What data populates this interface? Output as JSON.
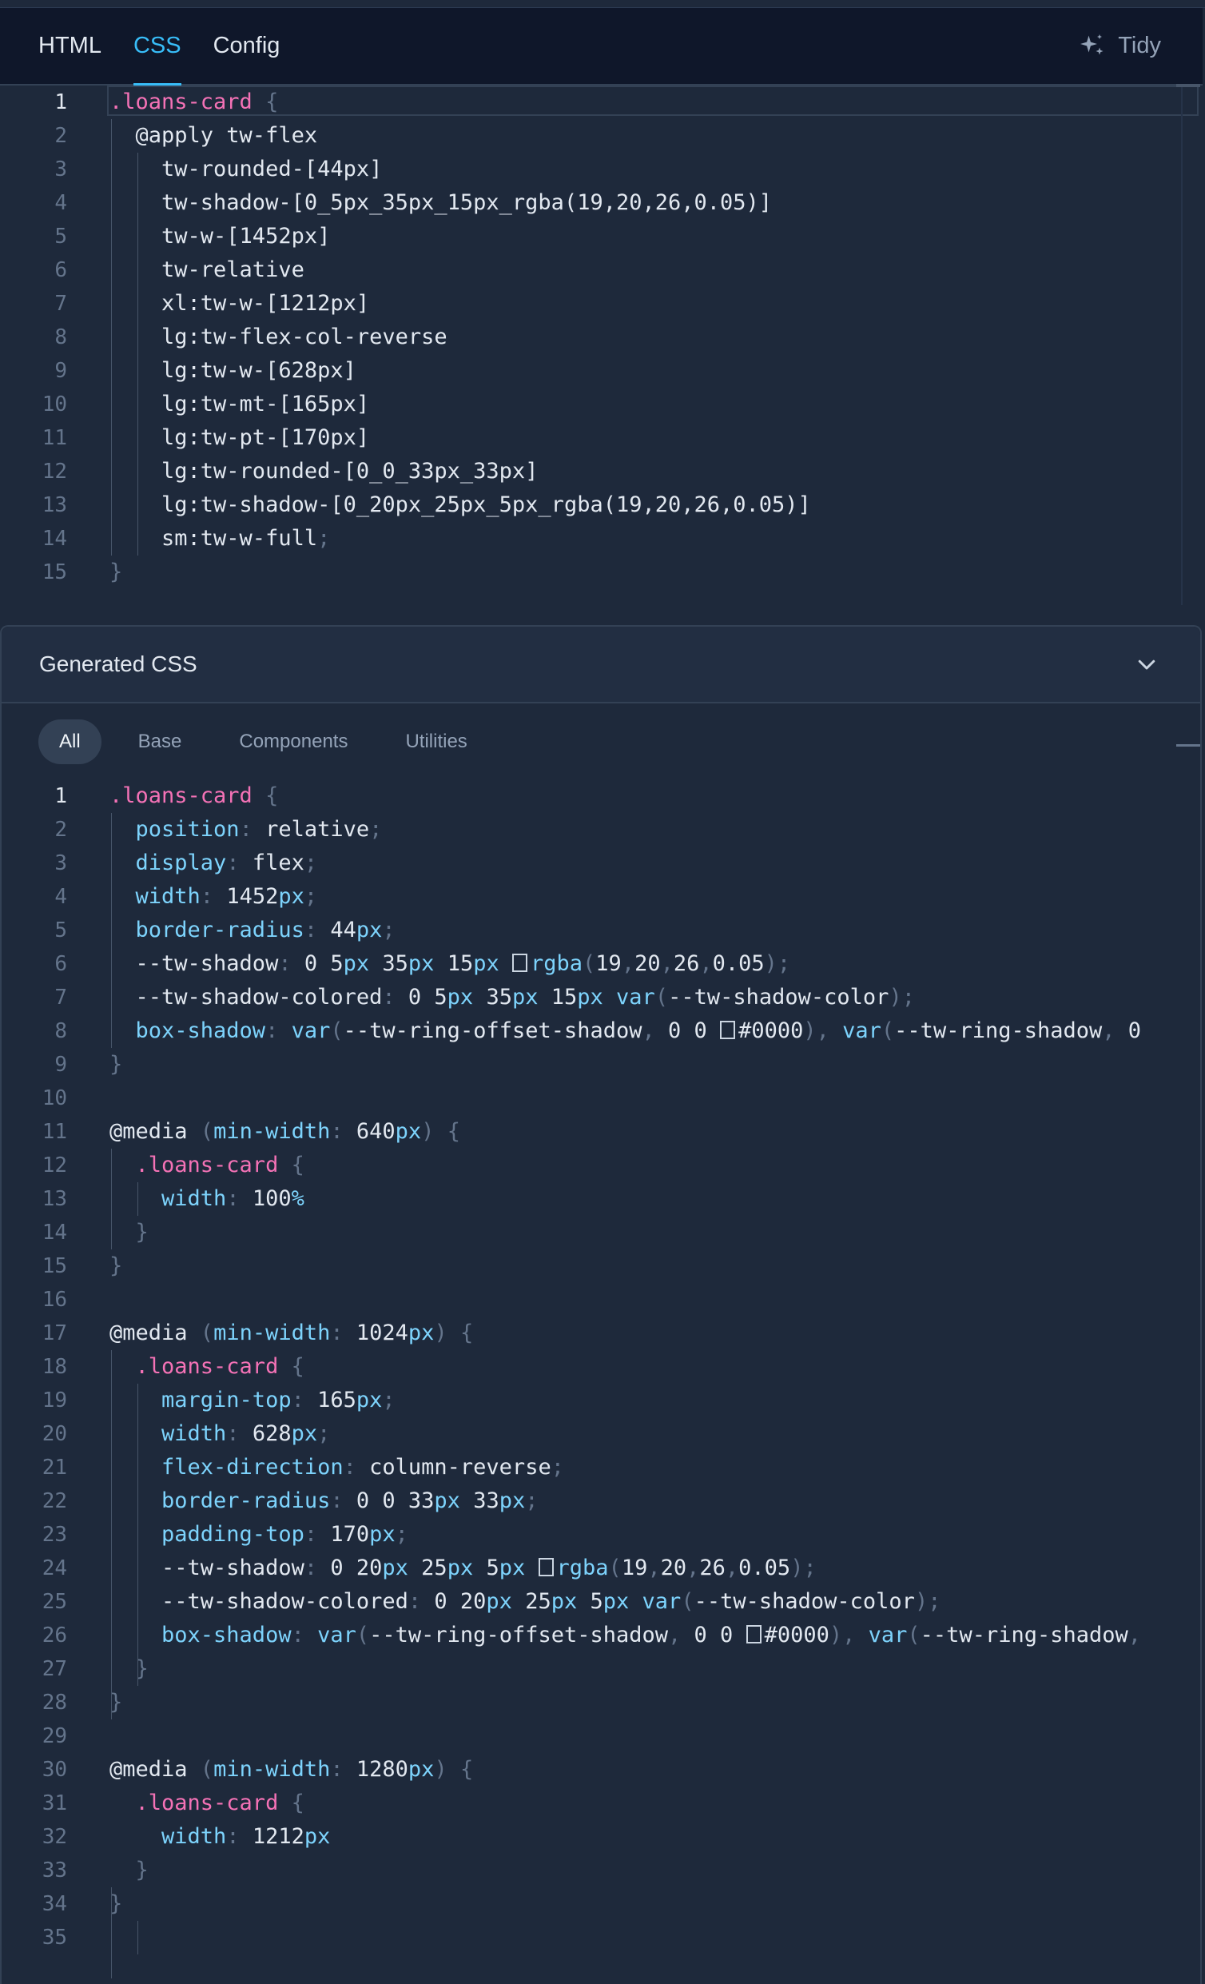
{
  "tabs": [
    {
      "label": "HTML",
      "active": false
    },
    {
      "label": "CSS",
      "active": true
    },
    {
      "label": "Config",
      "active": false
    }
  ],
  "tidy_label": "Tidy",
  "source": {
    "lines": [
      [
        {
          "t": ".loans-card",
          "c": "sel"
        },
        {
          "t": " {",
          "c": "brace"
        }
      ],
      [
        {
          "t": "  @apply tw-flex",
          "c": "val"
        }
      ],
      [
        {
          "t": "    tw-rounded-[44px]",
          "c": "val"
        }
      ],
      [
        {
          "t": "    tw-shadow-[0_5px_35px_15px_rgba(19,20,26,0.05)]",
          "c": "val"
        }
      ],
      [
        {
          "t": "    tw-w-[1452px]",
          "c": "val"
        }
      ],
      [
        {
          "t": "    tw-relative",
          "c": "val"
        }
      ],
      [
        {
          "t": "    xl:tw-w-[1212px]",
          "c": "val"
        }
      ],
      [
        {
          "t": "    lg:tw-flex-col-reverse",
          "c": "val"
        }
      ],
      [
        {
          "t": "    lg:tw-w-[628px]",
          "c": "val"
        }
      ],
      [
        {
          "t": "    lg:tw-mt-[165px]",
          "c": "val"
        }
      ],
      [
        {
          "t": "    lg:tw-pt-[170px]",
          "c": "val"
        }
      ],
      [
        {
          "t": "    lg:tw-rounded-[0_0_33px_33px]",
          "c": "val"
        }
      ],
      [
        {
          "t": "    lg:tw-shadow-[0_20px_25px_5px_rgba(19,20,26,0.05)]",
          "c": "val"
        }
      ],
      [
        {
          "t": "    sm:tw-w-full",
          "c": "val"
        },
        {
          "t": ";",
          "c": "punct"
        }
      ],
      [
        {
          "t": "}",
          "c": "brace"
        }
      ]
    ]
  },
  "generated": {
    "title": "Generated CSS",
    "filters": [
      {
        "label": "All",
        "active": true
      },
      {
        "label": "Base",
        "active": false
      },
      {
        "label": "Components",
        "active": false
      },
      {
        "label": "Utilities",
        "active": false
      }
    ],
    "lines": [
      [
        {
          "t": ".loans-card",
          "c": "sel"
        },
        {
          "t": " {",
          "c": "brace"
        }
      ],
      [
        {
          "t": "  position",
          "c": "prop"
        },
        {
          "t": ": ",
          "c": "punct"
        },
        {
          "t": "relative",
          "c": "val"
        },
        {
          "t": ";",
          "c": "punct"
        }
      ],
      [
        {
          "t": "  display",
          "c": "prop"
        },
        {
          "t": ": ",
          "c": "punct"
        },
        {
          "t": "flex",
          "c": "val"
        },
        {
          "t": ";",
          "c": "punct"
        }
      ],
      [
        {
          "t": "  width",
          "c": "prop"
        },
        {
          "t": ": ",
          "c": "punct"
        },
        {
          "t": "1452",
          "c": "val"
        },
        {
          "t": "px",
          "c": "unit"
        },
        {
          "t": ";",
          "c": "punct"
        }
      ],
      [
        {
          "t": "  border-radius",
          "c": "prop"
        },
        {
          "t": ": ",
          "c": "punct"
        },
        {
          "t": "44",
          "c": "val"
        },
        {
          "t": "px",
          "c": "unit"
        },
        {
          "t": ";",
          "c": "punct"
        }
      ],
      [
        {
          "t": "  --tw-shadow",
          "c": "val"
        },
        {
          "t": ": ",
          "c": "punct"
        },
        {
          "t": "0 5",
          "c": "val"
        },
        {
          "t": "px ",
          "c": "unit"
        },
        {
          "t": "35",
          "c": "val"
        },
        {
          "t": "px ",
          "c": "unit"
        },
        {
          "t": "15",
          "c": "val"
        },
        {
          "t": "px ",
          "c": "unit"
        },
        {
          "t": "",
          "c": "box"
        },
        {
          "t": "rgba",
          "c": "prop"
        },
        {
          "t": "(",
          "c": "punct"
        },
        {
          "t": "19",
          "c": "val"
        },
        {
          "t": ",",
          "c": "punct"
        },
        {
          "t": "20",
          "c": "val"
        },
        {
          "t": ",",
          "c": "punct"
        },
        {
          "t": "26",
          "c": "val"
        },
        {
          "t": ",",
          "c": "punct"
        },
        {
          "t": "0.05",
          "c": "val"
        },
        {
          "t": ");",
          "c": "punct"
        }
      ],
      [
        {
          "t": "  --tw-shadow-colored",
          "c": "val"
        },
        {
          "t": ": ",
          "c": "punct"
        },
        {
          "t": "0 5",
          "c": "val"
        },
        {
          "t": "px ",
          "c": "unit"
        },
        {
          "t": "35",
          "c": "val"
        },
        {
          "t": "px ",
          "c": "unit"
        },
        {
          "t": "15",
          "c": "val"
        },
        {
          "t": "px ",
          "c": "unit"
        },
        {
          "t": "var",
          "c": "prop"
        },
        {
          "t": "(",
          "c": "punct"
        },
        {
          "t": "--tw-shadow-color",
          "c": "val"
        },
        {
          "t": ");",
          "c": "punct"
        }
      ],
      [
        {
          "t": "  box-shadow",
          "c": "prop"
        },
        {
          "t": ": ",
          "c": "punct"
        },
        {
          "t": "var",
          "c": "prop"
        },
        {
          "t": "(",
          "c": "punct"
        },
        {
          "t": "--tw-ring-offset-shadow",
          "c": "val"
        },
        {
          "t": ", ",
          "c": "punct"
        },
        {
          "t": "0 0 ",
          "c": "val"
        },
        {
          "t": "",
          "c": "box"
        },
        {
          "t": "#0000",
          "c": "val"
        },
        {
          "t": "), ",
          "c": "punct"
        },
        {
          "t": "var",
          "c": "prop"
        },
        {
          "t": "(",
          "c": "punct"
        },
        {
          "t": "--tw-ring-shadow",
          "c": "val"
        },
        {
          "t": ", ",
          "c": "punct"
        },
        {
          "t": "0",
          "c": "val"
        }
      ],
      [
        {
          "t": "}",
          "c": "brace"
        }
      ],
      [],
      [
        {
          "t": "@media ",
          "c": "val"
        },
        {
          "t": "(",
          "c": "punct"
        },
        {
          "t": "min-width",
          "c": "prop"
        },
        {
          "t": ": ",
          "c": "punct"
        },
        {
          "t": "640",
          "c": "val"
        },
        {
          "t": "px",
          "c": "unit"
        },
        {
          "t": ") {",
          "c": "punct"
        }
      ],
      [
        {
          "t": "  .loans-card",
          "c": "sel"
        },
        {
          "t": " {",
          "c": "brace"
        }
      ],
      [
        {
          "t": "    width",
          "c": "prop"
        },
        {
          "t": ": ",
          "c": "punct"
        },
        {
          "t": "100",
          "c": "val"
        },
        {
          "t": "%",
          "c": "pct"
        }
      ],
      [
        {
          "t": "  }",
          "c": "brace"
        }
      ],
      [
        {
          "t": "}",
          "c": "brace"
        }
      ],
      [],
      [
        {
          "t": "@media ",
          "c": "val"
        },
        {
          "t": "(",
          "c": "punct"
        },
        {
          "t": "min-width",
          "c": "prop"
        },
        {
          "t": ": ",
          "c": "punct"
        },
        {
          "t": "1024",
          "c": "val"
        },
        {
          "t": "px",
          "c": "unit"
        },
        {
          "t": ") {",
          "c": "punct"
        }
      ],
      [
        {
          "t": "  .loans-card",
          "c": "sel"
        },
        {
          "t": " {",
          "c": "brace"
        }
      ],
      [
        {
          "t": "    margin-top",
          "c": "prop"
        },
        {
          "t": ": ",
          "c": "punct"
        },
        {
          "t": "165",
          "c": "val"
        },
        {
          "t": "px",
          "c": "unit"
        },
        {
          "t": ";",
          "c": "punct"
        }
      ],
      [
        {
          "t": "    width",
          "c": "prop"
        },
        {
          "t": ": ",
          "c": "punct"
        },
        {
          "t": "628",
          "c": "val"
        },
        {
          "t": "px",
          "c": "unit"
        },
        {
          "t": ";",
          "c": "punct"
        }
      ],
      [
        {
          "t": "    flex-direction",
          "c": "prop"
        },
        {
          "t": ": ",
          "c": "punct"
        },
        {
          "t": "column-reverse",
          "c": "val"
        },
        {
          "t": ";",
          "c": "punct"
        }
      ],
      [
        {
          "t": "    border-radius",
          "c": "prop"
        },
        {
          "t": ": ",
          "c": "punct"
        },
        {
          "t": "0 0 33",
          "c": "val"
        },
        {
          "t": "px ",
          "c": "unit"
        },
        {
          "t": "33",
          "c": "val"
        },
        {
          "t": "px",
          "c": "unit"
        },
        {
          "t": ";",
          "c": "punct"
        }
      ],
      [
        {
          "t": "    padding-top",
          "c": "prop"
        },
        {
          "t": ": ",
          "c": "punct"
        },
        {
          "t": "170",
          "c": "val"
        },
        {
          "t": "px",
          "c": "unit"
        },
        {
          "t": ";",
          "c": "punct"
        }
      ],
      [
        {
          "t": "    --tw-shadow",
          "c": "val"
        },
        {
          "t": ": ",
          "c": "punct"
        },
        {
          "t": "0 20",
          "c": "val"
        },
        {
          "t": "px ",
          "c": "unit"
        },
        {
          "t": "25",
          "c": "val"
        },
        {
          "t": "px ",
          "c": "unit"
        },
        {
          "t": "5",
          "c": "val"
        },
        {
          "t": "px ",
          "c": "unit"
        },
        {
          "t": "",
          "c": "box"
        },
        {
          "t": "rgba",
          "c": "prop"
        },
        {
          "t": "(",
          "c": "punct"
        },
        {
          "t": "19",
          "c": "val"
        },
        {
          "t": ",",
          "c": "punct"
        },
        {
          "t": "20",
          "c": "val"
        },
        {
          "t": ",",
          "c": "punct"
        },
        {
          "t": "26",
          "c": "val"
        },
        {
          "t": ",",
          "c": "punct"
        },
        {
          "t": "0.05",
          "c": "val"
        },
        {
          "t": ");",
          "c": "punct"
        }
      ],
      [
        {
          "t": "    --tw-shadow-colored",
          "c": "val"
        },
        {
          "t": ": ",
          "c": "punct"
        },
        {
          "t": "0 20",
          "c": "val"
        },
        {
          "t": "px ",
          "c": "unit"
        },
        {
          "t": "25",
          "c": "val"
        },
        {
          "t": "px ",
          "c": "unit"
        },
        {
          "t": "5",
          "c": "val"
        },
        {
          "t": "px ",
          "c": "unit"
        },
        {
          "t": "var",
          "c": "prop"
        },
        {
          "t": "(",
          "c": "punct"
        },
        {
          "t": "--tw-shadow-color",
          "c": "val"
        },
        {
          "t": ");",
          "c": "punct"
        }
      ],
      [
        {
          "t": "    box-shadow",
          "c": "prop"
        },
        {
          "t": ": ",
          "c": "punct"
        },
        {
          "t": "var",
          "c": "prop"
        },
        {
          "t": "(",
          "c": "punct"
        },
        {
          "t": "--tw-ring-offset-shadow",
          "c": "val"
        },
        {
          "t": ", ",
          "c": "punct"
        },
        {
          "t": "0 0 ",
          "c": "val"
        },
        {
          "t": "",
          "c": "box"
        },
        {
          "t": "#0000",
          "c": "val"
        },
        {
          "t": "), ",
          "c": "punct"
        },
        {
          "t": "var",
          "c": "prop"
        },
        {
          "t": "(",
          "c": "punct"
        },
        {
          "t": "--tw-ring-shadow",
          "c": "val"
        },
        {
          "t": ",",
          "c": "punct"
        }
      ],
      [
        {
          "t": "  }",
          "c": "brace"
        }
      ],
      [
        {
          "t": "}",
          "c": "brace"
        }
      ],
      [],
      [
        {
          "t": "@media ",
          "c": "val"
        },
        {
          "t": "(",
          "c": "punct"
        },
        {
          "t": "min-width",
          "c": "prop"
        },
        {
          "t": ": ",
          "c": "punct"
        },
        {
          "t": "1280",
          "c": "val"
        },
        {
          "t": "px",
          "c": "unit"
        },
        {
          "t": ") {",
          "c": "punct"
        }
      ],
      [
        {
          "t": "  .loans-card",
          "c": "sel"
        },
        {
          "t": " {",
          "c": "brace"
        }
      ],
      [
        {
          "t": "    width",
          "c": "prop"
        },
        {
          "t": ": ",
          "c": "punct"
        },
        {
          "t": "1212",
          "c": "val"
        },
        {
          "t": "px",
          "c": "unit"
        }
      ],
      [
        {
          "t": "  }",
          "c": "brace"
        }
      ],
      [
        {
          "t": "}",
          "c": "brace"
        }
      ],
      []
    ]
  }
}
